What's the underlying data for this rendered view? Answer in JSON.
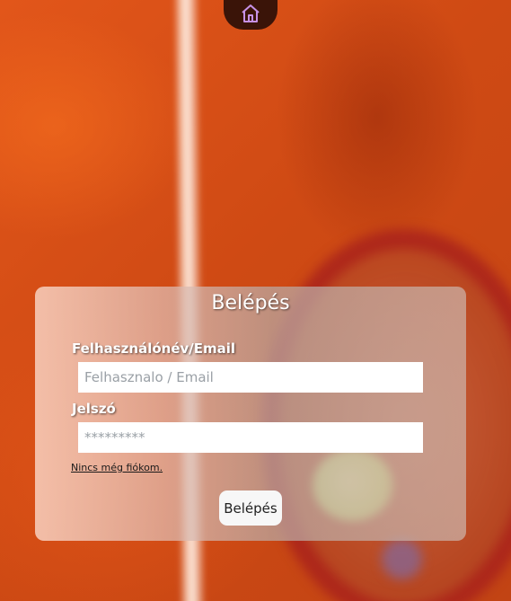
{
  "nav": {
    "home_icon": "home-icon",
    "icon_color": "#c792e6",
    "tab_color": "#3a1408"
  },
  "login": {
    "title": "Belépés",
    "username_label": "Felhasználónév/Email",
    "username_placeholder": "Felhasznalo / Email",
    "password_label": "Jelszó",
    "password_placeholder": "*********",
    "signup_link": "Nincs még fiókom.",
    "submit_label": "Belépés"
  }
}
